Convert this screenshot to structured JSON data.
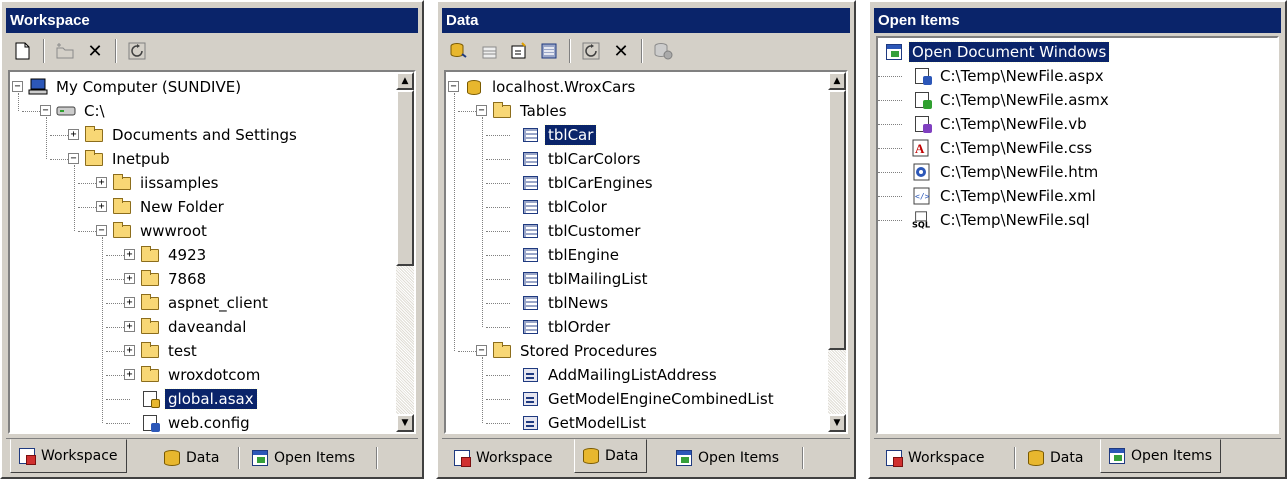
{
  "panels": {
    "workspace": {
      "title": "Workspace",
      "toolbar": [
        "new-file-icon",
        "new-folder-icon",
        "delete-icon",
        "refresh-icon"
      ],
      "tree": [
        {
          "label": "My Computer (SUNDIVE)",
          "icon": "computer-icon",
          "level": 0,
          "expander": "−"
        },
        {
          "label": "C:\\",
          "icon": "drive-icon",
          "level": 1,
          "expander": "−"
        },
        {
          "label": "Documents and Settings",
          "icon": "folder-icon",
          "level": 2,
          "expander": "+"
        },
        {
          "label": "Inetpub",
          "icon": "folder-icon",
          "level": 2,
          "expander": "−"
        },
        {
          "label": "iissamples",
          "icon": "folder-icon",
          "level": 3,
          "expander": "+"
        },
        {
          "label": "New Folder",
          "icon": "folder-icon",
          "level": 3,
          "expander": "+"
        },
        {
          "label": "wwwroot",
          "icon": "folder-icon",
          "level": 3,
          "expander": "−"
        },
        {
          "label": "4923",
          "icon": "folder-icon",
          "level": 4,
          "expander": "+"
        },
        {
          "label": "7868",
          "icon": "folder-icon",
          "level": 4,
          "expander": "+"
        },
        {
          "label": "aspnet_client",
          "icon": "folder-icon",
          "level": 4,
          "expander": "+"
        },
        {
          "label": "daveandal",
          "icon": "folder-icon",
          "level": 4,
          "expander": "+"
        },
        {
          "label": "test",
          "icon": "folder-icon",
          "level": 4,
          "expander": "+"
        },
        {
          "label": "wroxdotcom",
          "icon": "folder-icon",
          "level": 4,
          "expander": "+"
        },
        {
          "label": "global.asax",
          "icon": "asax-file-icon",
          "level": 4,
          "expander": "",
          "selected": true
        },
        {
          "label": "web.config",
          "icon": "config-file-icon",
          "level": 4,
          "expander": ""
        }
      ]
    },
    "data": {
      "title": "Data",
      "toolbar": [
        "add-connection-icon",
        "new-table-icon",
        "new-procedure-icon",
        "table-view-icon",
        "refresh-icon",
        "delete-icon",
        "disconnect-icon"
      ],
      "tree": [
        {
          "label": "localhost.WroxCars",
          "icon": "database-icon",
          "level": 0,
          "expander": "−"
        },
        {
          "label": "Tables",
          "icon": "tables-folder-icon",
          "level": 1,
          "expander": "−"
        },
        {
          "label": "tblCar",
          "icon": "table-icon",
          "level": 2,
          "expander": "",
          "selected": true
        },
        {
          "label": "tblCarColors",
          "icon": "table-icon",
          "level": 2,
          "expander": ""
        },
        {
          "label": "tblCarEngines",
          "icon": "table-icon",
          "level": 2,
          "expander": ""
        },
        {
          "label": "tblColor",
          "icon": "table-icon",
          "level": 2,
          "expander": ""
        },
        {
          "label": "tblCustomer",
          "icon": "table-icon",
          "level": 2,
          "expander": ""
        },
        {
          "label": "tblEngine",
          "icon": "table-icon",
          "level": 2,
          "expander": ""
        },
        {
          "label": "tblMailingList",
          "icon": "table-icon",
          "level": 2,
          "expander": ""
        },
        {
          "label": "tblNews",
          "icon": "table-icon",
          "level": 2,
          "expander": ""
        },
        {
          "label": "tblOrder",
          "icon": "table-icon",
          "level": 2,
          "expander": ""
        },
        {
          "label": "Stored Procedures",
          "icon": "procedures-folder-icon",
          "level": 1,
          "expander": "−"
        },
        {
          "label": "AddMailingListAddress",
          "icon": "procedure-icon",
          "level": 2,
          "expander": ""
        },
        {
          "label": "GetModelEngineCombinedList",
          "icon": "procedure-icon",
          "level": 2,
          "expander": ""
        },
        {
          "label": "GetModelList",
          "icon": "procedure-icon",
          "level": 2,
          "expander": ""
        }
      ]
    },
    "open_items": {
      "title": "Open Items",
      "tree": [
        {
          "label": "Open Document Windows",
          "icon": "open-windows-icon",
          "level": 0,
          "expander": "",
          "selected": true
        },
        {
          "label": "C:\\Temp\\NewFile.aspx",
          "icon": "aspx-file-icon",
          "level": 1
        },
        {
          "label": "C:\\Temp\\NewFile.asmx",
          "icon": "asmx-file-icon",
          "level": 1
        },
        {
          "label": "C:\\Temp\\NewFile.vb",
          "icon": "vb-file-icon",
          "level": 1
        },
        {
          "label": "C:\\Temp\\NewFile.css",
          "icon": "css-file-icon",
          "level": 1
        },
        {
          "label": "C:\\Temp\\NewFile.htm",
          "icon": "htm-file-icon",
          "level": 1
        },
        {
          "label": "C:\\Temp\\NewFile.xml",
          "icon": "xml-file-icon",
          "level": 1
        },
        {
          "label": "C:\\Temp\\NewFile.sql",
          "icon": "sql-file-icon",
          "level": 1
        }
      ]
    }
  },
  "tabs": [
    {
      "label": "Workspace",
      "icon": "workspace-tab-icon"
    },
    {
      "label": "Data",
      "icon": "data-tab-icon"
    },
    {
      "label": "Open Items",
      "icon": "open-items-tab-icon"
    }
  ],
  "colors": {
    "titlebar": "#0a246a",
    "selection": "#0a246a",
    "chrome": "#d4d0c8"
  }
}
